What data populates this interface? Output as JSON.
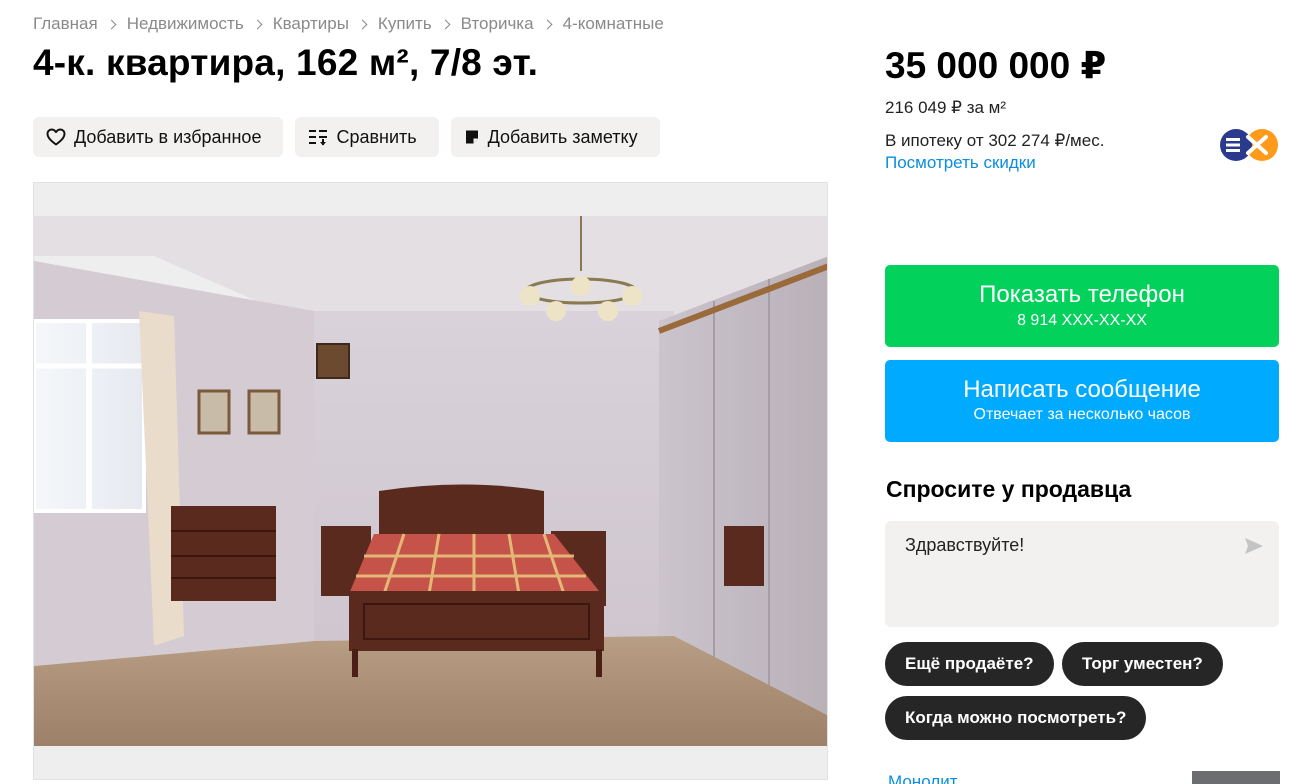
{
  "breadcrumbs": [
    "Главная",
    "Недвижимость",
    "Квартиры",
    "Купить",
    "Вторичка",
    "4-комнатные"
  ],
  "listing": {
    "title": "4-к. квартира, 162 м², 7/8 эт."
  },
  "actions": {
    "favorite": {
      "label": "Добавить в избранное",
      "icon": "heart-outline-icon"
    },
    "compare": {
      "label": "Сравнить",
      "icon": "compare-list-icon"
    },
    "note": {
      "label": "Добавить заметку",
      "icon": "note-icon"
    }
  },
  "gallery": {
    "scene": "bedroom"
  },
  "price": {
    "total": "35 000 000 ₽",
    "per_meter": "216 049 ₽ за м²",
    "mortgage": "В ипотеку от 302 274 ₽/мес.",
    "discounts_link": "Посмотреть скидки",
    "bank_logo_icon": "bank-logo-icon"
  },
  "contact": {
    "phone_button": {
      "label": "Показать телефон",
      "sub": "8 914 XXX-XX-XX"
    },
    "message_button": {
      "label": "Написать сообщение",
      "sub": "Отвечает за несколько часов"
    }
  },
  "ask_seller": {
    "title": "Спросите у продавца",
    "message": "Здравствуйте!",
    "send_icon": "send-icon",
    "quick_questions": [
      "Ещё продаёте?",
      "Торг уместен?",
      "Когда можно посмотреть?"
    ]
  },
  "footer_partial": {
    "link": "Монолит"
  },
  "colors": {
    "phone_button": "#02d15c",
    "message_button": "#00aaff",
    "link": "#0a8ee0",
    "chip": "#262626",
    "soft_button": "#f2f1f0"
  }
}
